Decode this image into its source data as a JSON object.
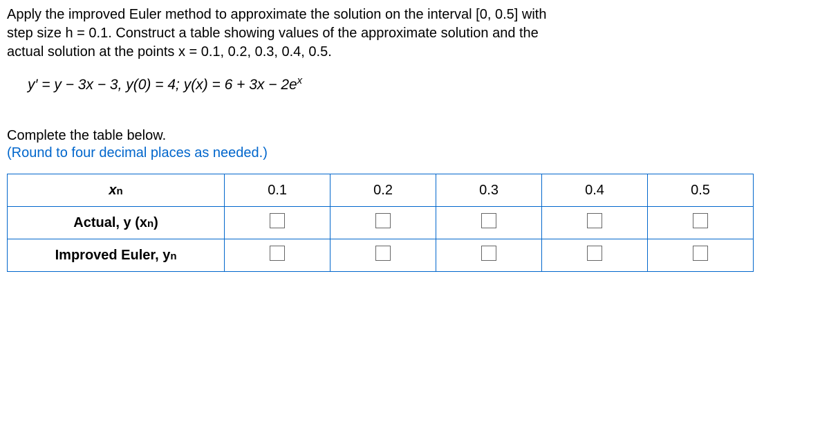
{
  "problem": {
    "line1": "Apply the improved Euler method to approximate the solution on the interval [0, 0.5] with",
    "line2": "step size h = 0.1. Construct a table showing values of the approximate solution and the",
    "line3": "actual solution at the points x = 0.1, 0.2, 0.3, 0.4, 0.5."
  },
  "equation": {
    "text": "y′ = y − 3x − 3, y(0) = 4; y(x) = 6 + 3x − 2e",
    "sup": "x"
  },
  "instructions": {
    "line1": "Complete the table below.",
    "line2": "(Round to four decimal places as needed.)"
  },
  "table": {
    "headers": {
      "xn": "x",
      "actual": "Actual, y (x",
      "actual_close": ")",
      "improved": "Improved Euler, y"
    },
    "x_values": [
      "0.1",
      "0.2",
      "0.3",
      "0.4",
      "0.5"
    ]
  }
}
